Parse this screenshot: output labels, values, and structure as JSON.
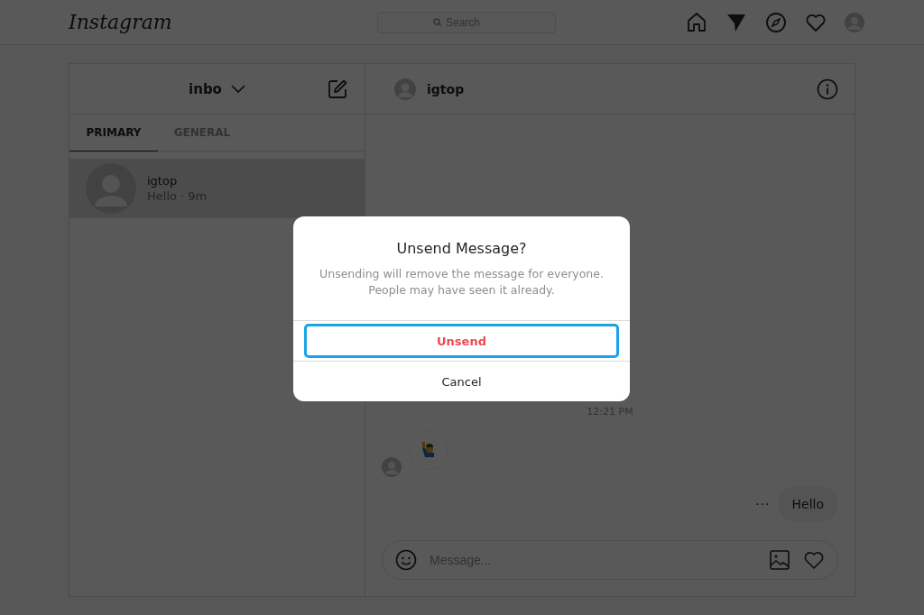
{
  "header": {
    "logo": "Instagram",
    "search": {
      "placeholder": "Search"
    }
  },
  "inbox": {
    "account": "inbo",
    "tabs": [
      {
        "label": "PRIMARY",
        "selected": true
      },
      {
        "label": "GENERAL",
        "selected": false
      }
    ],
    "conversations": [
      {
        "name": "igtop",
        "preview": "Hello · 9m",
        "selected": true
      }
    ]
  },
  "chat": {
    "name": "igtop",
    "timestamp": "12:21 PM",
    "messages": [
      {
        "kind": "emoji"
      },
      {
        "kind": "text",
        "text": "Hello",
        "more": "···"
      }
    ],
    "composer": {
      "placeholder": "Message..."
    }
  },
  "dialog": {
    "title": "Unsend Message?",
    "body": [
      "Unsending will remove the message for everyone.",
      "People may have seen it already."
    ],
    "actions": [
      {
        "label": "Unsend",
        "kind": "destructive",
        "highlighted": true
      },
      {
        "label": "Cancel",
        "kind": "normal",
        "highlighted": false
      }
    ]
  }
}
